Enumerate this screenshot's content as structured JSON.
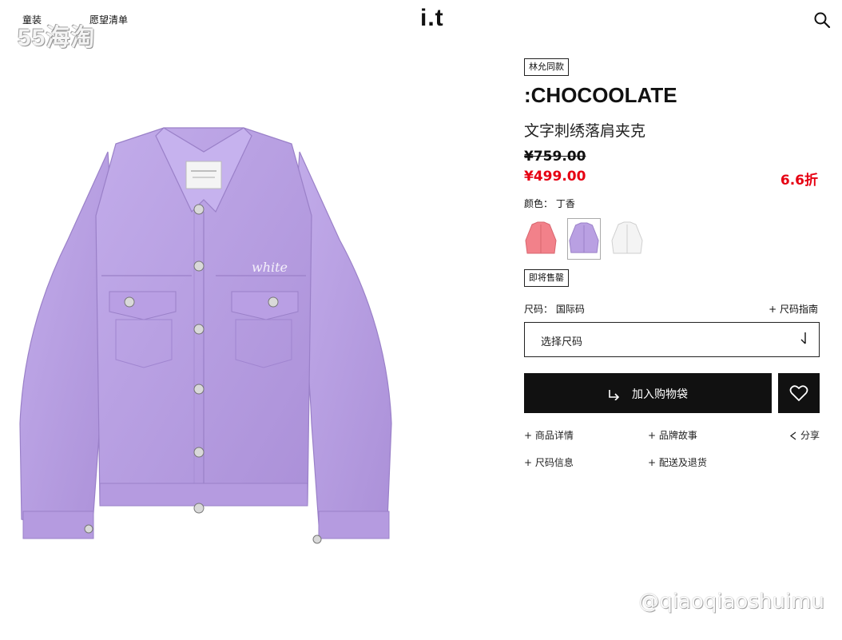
{
  "header": {
    "nav": [
      "童装",
      "愿望清单"
    ],
    "logo": "i.t",
    "watermark": "55海淘"
  },
  "product": {
    "celebrity_tag": "林允同款",
    "brand": ":CHOCOOLATE",
    "name": "文字刺绣落肩夹克",
    "original_price": "¥759.00",
    "sale_price": "¥499.00",
    "discount": "6.6折",
    "color_label": "颜色： 丁香",
    "swatches": [
      {
        "name": "pink",
        "color": "#f2818a"
      },
      {
        "name": "lilac",
        "color": "#b9a0e2",
        "selected": true
      },
      {
        "name": "white",
        "color": "#f2f2f2"
      }
    ],
    "stock_tag": "即将售罄",
    "size_label": "尺码： 国际码",
    "size_guide": "+ 尺码指南",
    "size_placeholder": "选择尺码",
    "add_to_cart": "加入购物袋",
    "links": {
      "detail": "+ 商品详情",
      "brand_story": "+ 品牌故事",
      "share": "分享",
      "size_info": "+ 尺码信息",
      "shipping": "+ 配送及退货"
    },
    "jacket_color": "#b9a0e2",
    "embroidery": "white"
  },
  "watermark_bottom": "@qiaoqiaoshuimu",
  "colors": {
    "accent": "#e60012",
    "button": "#111111"
  }
}
